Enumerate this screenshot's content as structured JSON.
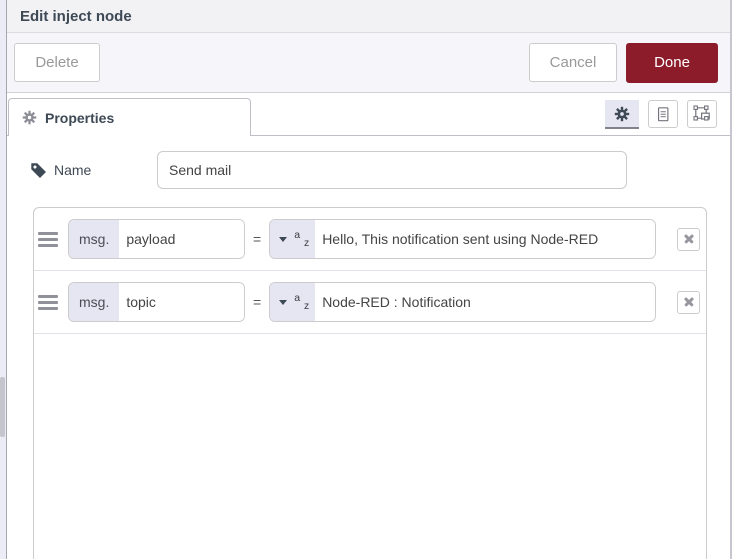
{
  "window": {
    "title": "Edit inject node"
  },
  "toolbar": {
    "delete_label": "Delete",
    "cancel_label": "Cancel",
    "done_label": "Done"
  },
  "tab_bar": {
    "properties_tab_label": "Properties",
    "icon_buttons": [
      "properties",
      "description",
      "appearance"
    ]
  },
  "form": {
    "name_label": "Name",
    "name_value": "Send mail",
    "props_rows": [
      {
        "prefix": "msg.",
        "name": "payload",
        "operator": "=",
        "type": "string",
        "value": "Hello, This notification sent using Node-RED"
      },
      {
        "prefix": "msg.",
        "name": "topic",
        "operator": "=",
        "type": "string",
        "value": "Node-RED : Notification"
      }
    ]
  },
  "icons": {
    "string_type": {
      "top": "a",
      "bottom": "z"
    },
    "names": [
      "gear-icon",
      "document-icon",
      "appearance-icon",
      "tag-icon",
      "drag-handle-icon",
      "caret-down-icon",
      "string-type-icon",
      "close-icon"
    ]
  },
  "colors": {
    "primary_button": "#8c1c2a",
    "accent_lavender": "#e6e6f2",
    "header_text": "#3e4956",
    "header_bg": "#f2f2f5"
  }
}
